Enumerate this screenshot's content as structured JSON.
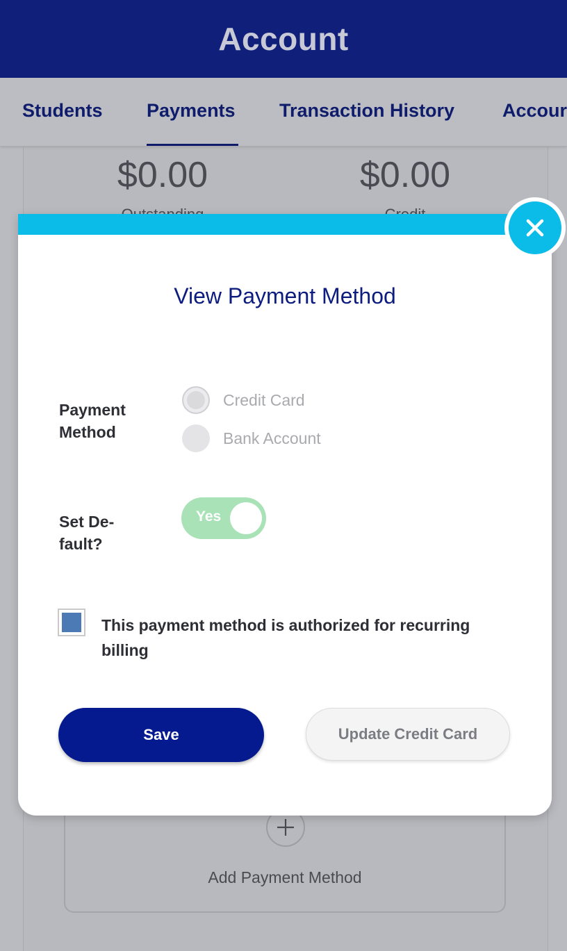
{
  "header": {
    "title": "Account"
  },
  "tabs": [
    {
      "label": "Students"
    },
    {
      "label": "Payments"
    },
    {
      "label": "Transaction History"
    },
    {
      "label": "Accour"
    }
  ],
  "summary": {
    "outstanding_amount": "$0.00",
    "outstanding_label": "Outstanding",
    "credit_amount": "$0.00",
    "credit_label": "Credit"
  },
  "add_payment": {
    "label": "Add Payment Method",
    "icon": "plus-icon"
  },
  "modal": {
    "title": "View Payment Method",
    "close_icon": "close-icon",
    "payment_method": {
      "label_line1": "Payment",
      "label_line2": "Method",
      "options": [
        "Credit Card",
        "Bank Account"
      ],
      "selected": "Credit Card"
    },
    "set_default": {
      "label_line1": "Set De-",
      "label_line2": "fault?",
      "toggle_text": "Yes",
      "on": true
    },
    "recurring": {
      "checked": true,
      "label": "This payment method is authorized for recurring billing"
    },
    "buttons": {
      "save": "Save",
      "update": "Update Credit Card"
    }
  },
  "colors": {
    "header": "#101f7a",
    "accent": "#0bbbe8",
    "primary_button": "#051a8e",
    "toggle_on": "#a9e2b7",
    "checkbox": "#4b7ab5"
  }
}
